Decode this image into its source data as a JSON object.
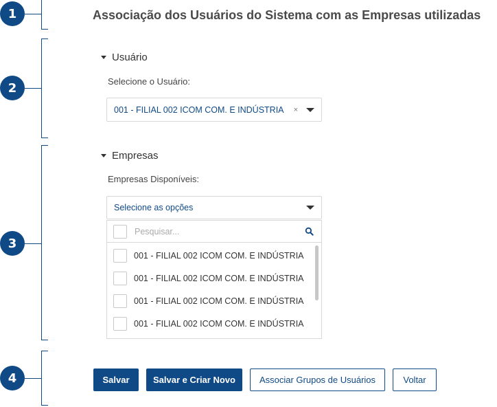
{
  "markers": [
    "1",
    "2",
    "3",
    "4"
  ],
  "page_title": "Associação dos Usuários do Sistema com as Empresas utilizadas",
  "usuario_section": {
    "toggle_label": "Usuário",
    "field_label": "Selecione o Usuário:",
    "selected_value": "001 - FILIAL 002 ICOM COM. E INDÚSTRIA",
    "clear_glyph": "×"
  },
  "empresas_section": {
    "toggle_label": "Empresas",
    "field_label": "Empresas Disponíveis:",
    "select_placeholder": "Selecione as opções",
    "search_placeholder": "Pesquisar...",
    "options": [
      "001 - FILIAL 002 ICOM COM. E INDÚSTRIA",
      "001 - FILIAL 002 ICOM COM. E INDÚSTRIA",
      "001 - FILIAL 002 ICOM COM. E INDÚSTRIA",
      "001 - FILIAL 002 ICOM COM. E INDÚSTRIA"
    ]
  },
  "buttons": {
    "save": "Salvar",
    "save_new": "Salvar e Criar Novo",
    "associate_groups": "Associar Grupos de Usuários",
    "back": "Voltar"
  },
  "colors": {
    "accent": "#0f4a86",
    "title": "#4a4a4a",
    "border": "#d7d7d7"
  }
}
